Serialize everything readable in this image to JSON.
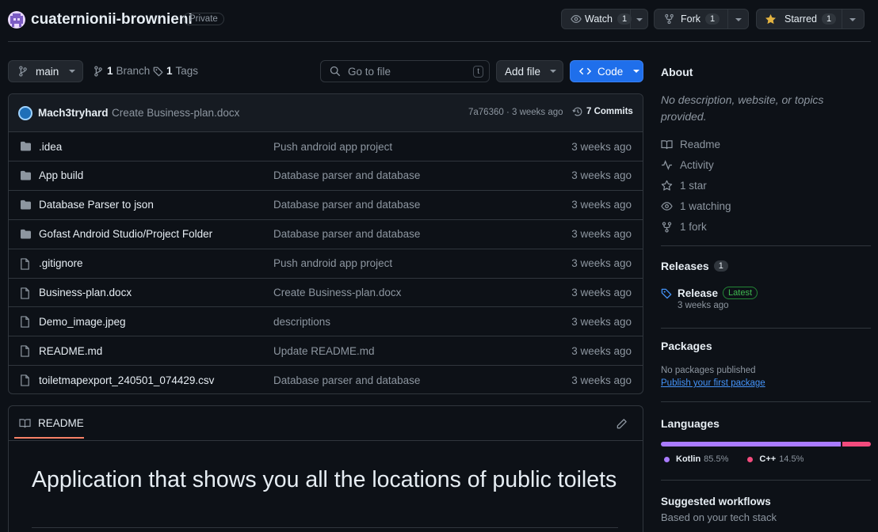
{
  "repo": {
    "name": "cuaternionii-brownieni",
    "visibility": "Private"
  },
  "header_actions": {
    "watch_label": "Watch",
    "watch_count": "1",
    "fork_label": "Fork",
    "fork_count": "1",
    "star_label": "Starred",
    "star_count": "1"
  },
  "toolbar": {
    "branch": "main",
    "branches_count": "1",
    "branches_label": "Branch",
    "tags_count": "1",
    "tags_label": "Tags",
    "search_placeholder": "Go to file",
    "search_shortcut": "t",
    "add_file_label": "Add file",
    "code_label": "Code"
  },
  "commit": {
    "author": "Mach3tryhard",
    "message": "Create Business-plan.docx",
    "hash_time": "7a76360 · 3 weeks ago",
    "commits_label": "7 Commits"
  },
  "files": [
    {
      "name": ".idea",
      "type": "folder",
      "message": "Push android app project",
      "time": "3 weeks ago"
    },
    {
      "name": "App build",
      "type": "folder",
      "message": "Database parser and database",
      "time": "3 weeks ago"
    },
    {
      "name": "Database Parser to json",
      "type": "folder",
      "message": "Database parser and database",
      "time": "3 weeks ago"
    },
    {
      "name": "Gofast Android Studio/Project Folder",
      "type": "folder",
      "message": "Database parser and database",
      "time": "3 weeks ago"
    },
    {
      "name": ".gitignore",
      "type": "file",
      "message": "Push android app project",
      "time": "3 weeks ago"
    },
    {
      "name": "Business-plan.docx",
      "type": "file",
      "message": "Create Business-plan.docx",
      "time": "3 weeks ago"
    },
    {
      "name": "Demo_image.jpeg",
      "type": "file",
      "message": "descriptions",
      "time": "3 weeks ago"
    },
    {
      "name": "README.md",
      "type": "file",
      "message": "Update README.md",
      "time": "3 weeks ago"
    },
    {
      "name": "toiletmapexport_240501_074429.csv",
      "type": "file",
      "message": "Database parser and database",
      "time": "3 weeks ago"
    }
  ],
  "readme": {
    "tab_label": "README",
    "heading": "Application that shows you all the locations of public toilets"
  },
  "about": {
    "title": "About",
    "description": "No description, website, or topics provided.",
    "readme": "Readme",
    "activity": "Activity",
    "stars": "1 star",
    "watching": "1 watching",
    "forks": "1 fork"
  },
  "releases": {
    "title": "Releases",
    "count": "1",
    "release_name": "Release",
    "latest_badge": "Latest",
    "release_time": "3 weeks ago"
  },
  "packages": {
    "title": "Packages",
    "none_text": "No packages published",
    "publish_link": "Publish your first package"
  },
  "languages": {
    "title": "Languages",
    "items": [
      {
        "name": "Kotlin",
        "percent": "85.5%",
        "value": 85.5,
        "color": "#a97bff"
      },
      {
        "name": "C++",
        "percent": "14.5%",
        "value": 14.5,
        "color": "#f34b7d"
      }
    ]
  },
  "workflows": {
    "title": "Suggested workflows",
    "subtitle": "Based on your tech stack"
  },
  "colors": {
    "accent": "#1f6feb",
    "link": "#4493f8",
    "star": "#e3b341"
  }
}
